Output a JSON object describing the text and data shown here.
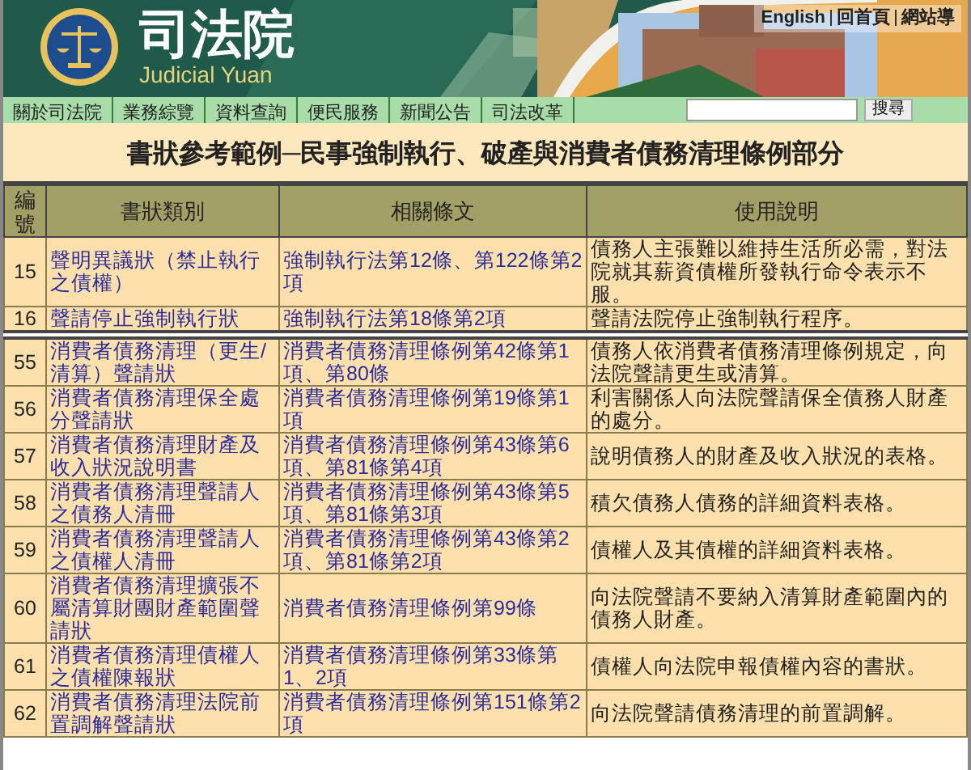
{
  "header": {
    "title": "司法院",
    "subtitle": "Judicial Yuan",
    "links": [
      "English",
      "回首頁",
      "網站導"
    ]
  },
  "nav": {
    "items": [
      "關於司法院",
      "業務綜覽",
      "資料查詢",
      "便民服務",
      "新聞公告",
      "司法改革"
    ],
    "search_button": "搜尋"
  },
  "table": {
    "title": "書狀參考範例─民事強制執行、破產與消費者債務清理條例部分",
    "columns": [
      "編號",
      "書狀類別",
      "相關條文",
      "使用說明"
    ],
    "sections": [
      [
        {
          "no": "15",
          "form": "聲明異議狀（禁止執行之債權）",
          "articles": "強制執行法第12條、第122條第2項",
          "usage": "債務人主張難以維持生活所必需，對法院就其薪資債權所發執行命令表示不服。"
        },
        {
          "no": "16",
          "form": "聲請停止強制執行狀",
          "articles": "強制執行法第18條第2項",
          "usage": "聲請法院停止強制執行程序。"
        }
      ],
      [
        {
          "no": "55",
          "form": "消費者債務清理（更生/清算）聲請狀",
          "articles": "消費者債務清理條例第42條第1項、第80條",
          "usage": "債務人依消費者債務清理條例規定，向法院聲請更生或清算。"
        },
        {
          "no": "56",
          "form": "消費者債務清理保全處分聲請狀",
          "articles": "消費者債務清理條例第19條第1項",
          "usage": "利害關係人向法院聲請保全債務人財產的處分。"
        },
        {
          "no": "57",
          "form": "消費者債務清理財產及收入狀況說明書",
          "articles": "消費者債務清理條例第43條第6項、第81條第4項",
          "usage": "說明債務人的財產及收入狀況的表格。"
        },
        {
          "no": "58",
          "form": "消費者債務清理聲請人之債務人清冊",
          "articles": "消費者債務清理條例第43條第5項、第81條第3項",
          "usage": "積欠債務人債務的詳細資料表格。"
        },
        {
          "no": "59",
          "form": "消費者債務清理聲請人之債權人清冊",
          "articles": "消費者債務清理條例第43條第2項、第81條第2項",
          "usage": "債權人及其債權的詳細資料表格。"
        },
        {
          "no": "60",
          "form": "消費者債務清理擴張不屬清算財團財產範圍聲請狀",
          "articles": "消費者債務清理條例第99條",
          "usage": "向法院聲請不要納入清算財產範圍內的債務人財產。"
        },
        {
          "no": "61",
          "form": "消費者債務清理債權人之債權陳報狀",
          "articles": "消費者債務清理條例第33條第1、2項",
          "usage": "債權人向法院申報債權內容的書狀。"
        },
        {
          "no": "62",
          "form": "消費者債務清理法院前置調解聲請狀",
          "articles": "消費者債務清理條例第151條第2項",
          "usage": "向法院聲請債務清理的前置調解。"
        }
      ]
    ]
  }
}
